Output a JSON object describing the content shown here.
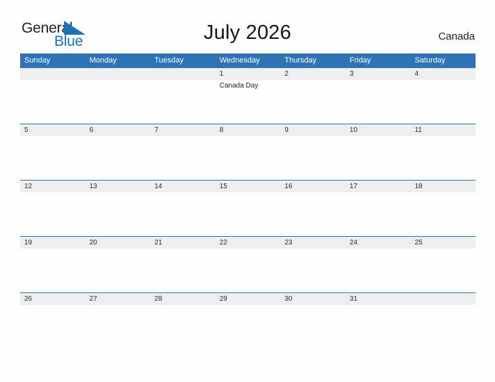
{
  "brand": {
    "name_part1": "General",
    "name_part2": "Blue",
    "flag_icon": "blue-flag-triangle-icon",
    "color_dark": "#231f20",
    "color_blue": "#1f6fbb"
  },
  "header": {
    "title": "July 2026",
    "country": "Canada"
  },
  "theme": {
    "header_blue": "#2e74b5",
    "date_band_gray": "#eeeeee",
    "cell_white": "#fdfdfd",
    "divider_blue": "#2e74b5"
  },
  "calendar": {
    "month": "July",
    "year": "2026",
    "weekday_headers": [
      "Sunday",
      "Monday",
      "Tuesday",
      "Wednesday",
      "Thursday",
      "Friday",
      "Saturday"
    ],
    "weeks": [
      {
        "days": [
          {
            "date": "",
            "events": []
          },
          {
            "date": "",
            "events": []
          },
          {
            "date": "",
            "events": []
          },
          {
            "date": "1",
            "events": [
              "Canada Day"
            ]
          },
          {
            "date": "2",
            "events": []
          },
          {
            "date": "3",
            "events": []
          },
          {
            "date": "4",
            "events": []
          }
        ]
      },
      {
        "days": [
          {
            "date": "5",
            "events": []
          },
          {
            "date": "6",
            "events": []
          },
          {
            "date": "7",
            "events": []
          },
          {
            "date": "8",
            "events": []
          },
          {
            "date": "9",
            "events": []
          },
          {
            "date": "10",
            "events": []
          },
          {
            "date": "11",
            "events": []
          }
        ]
      },
      {
        "days": [
          {
            "date": "12",
            "events": []
          },
          {
            "date": "13",
            "events": []
          },
          {
            "date": "14",
            "events": []
          },
          {
            "date": "15",
            "events": []
          },
          {
            "date": "16",
            "events": []
          },
          {
            "date": "17",
            "events": []
          },
          {
            "date": "18",
            "events": []
          }
        ]
      },
      {
        "days": [
          {
            "date": "19",
            "events": []
          },
          {
            "date": "20",
            "events": []
          },
          {
            "date": "21",
            "events": []
          },
          {
            "date": "22",
            "events": []
          },
          {
            "date": "23",
            "events": []
          },
          {
            "date": "24",
            "events": []
          },
          {
            "date": "25",
            "events": []
          }
        ]
      },
      {
        "days": [
          {
            "date": "26",
            "events": []
          },
          {
            "date": "27",
            "events": []
          },
          {
            "date": "28",
            "events": []
          },
          {
            "date": "29",
            "events": []
          },
          {
            "date": "30",
            "events": []
          },
          {
            "date": "31",
            "events": []
          },
          {
            "date": "",
            "events": []
          }
        ]
      }
    ]
  }
}
